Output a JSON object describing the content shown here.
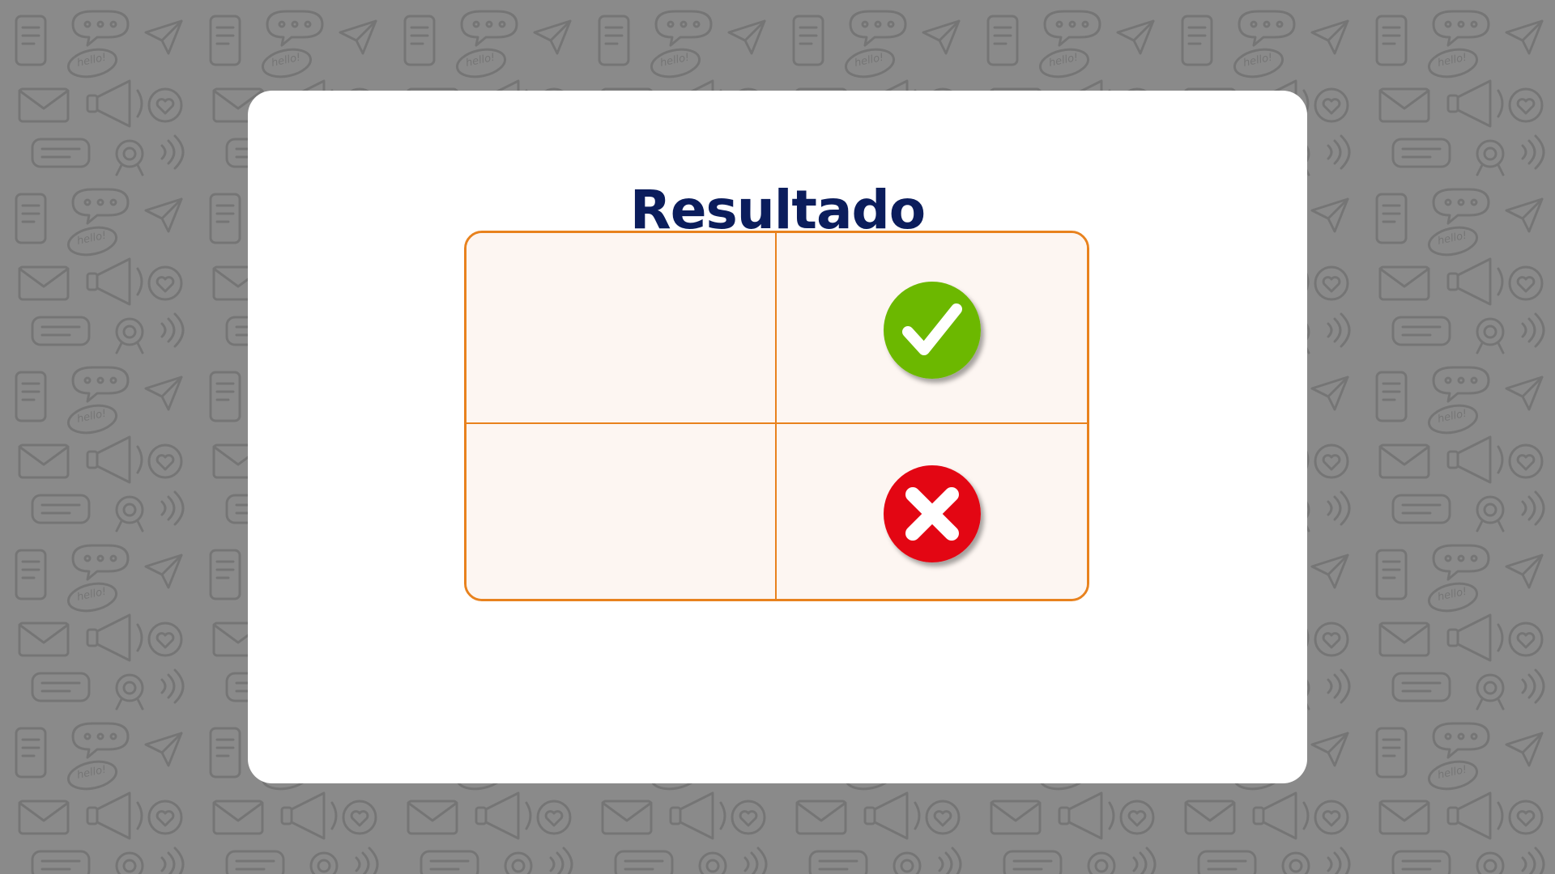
{
  "page": {
    "background_color": "#8a8a8a",
    "pattern_color": "#5c5c5c",
    "pattern_text": "hello!"
  },
  "card": {
    "title": "Resultado",
    "title_color": "#0b1d5c",
    "background_color": "#ffffff"
  },
  "table": {
    "border_color": "#e8821e",
    "cell_color": "#fdf6f2",
    "rows": [
      {
        "label": "",
        "status": "correct",
        "icon": "check-icon",
        "icon_color": "#6cb800"
      },
      {
        "label": "",
        "status": "incorrect",
        "icon": "x-icon",
        "icon_color": "#e30613"
      }
    ]
  }
}
